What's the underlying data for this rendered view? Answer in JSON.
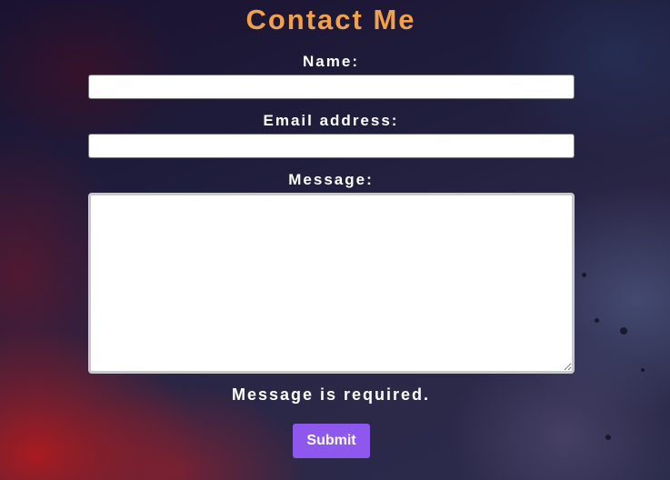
{
  "page": {
    "title": "Contact Me"
  },
  "form": {
    "name_label": "Name:",
    "name_value": "",
    "email_label": "Email address:",
    "email_value": "",
    "message_label": "Message:",
    "message_value": "",
    "error_text": "Message is required.",
    "submit_label": "Submit"
  },
  "colors": {
    "title": "#f2a04a",
    "submit_button": "#8e57ee",
    "label_text": "#ffffff"
  }
}
